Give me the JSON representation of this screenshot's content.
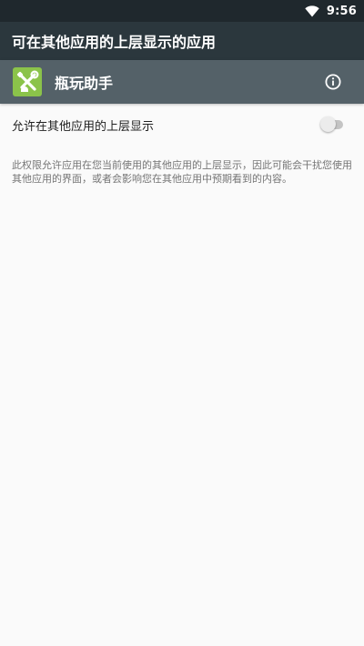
{
  "status_bar": {
    "time": "9:56",
    "icons": [
      "wifi-icon"
    ]
  },
  "app_bar": {
    "title": "可在其他应用的上层显示的应用"
  },
  "app_header": {
    "name": "瓶玩助手",
    "icon": "wrench-icon",
    "action_icon": "info-icon"
  },
  "setting": {
    "label": "允许在其他应用的上层显示",
    "enabled": false
  },
  "description": "此权限允许应用在您当前使用的其他应用的上层显示，因此可能会干扰您使用其他应用的界面，或者会影响您在其他应用中预期看到的内容。",
  "colors": {
    "status_bar": "#1f282d",
    "app_bar": "#2b373d",
    "app_header": "#546168",
    "app_icon_bg": "#8bc34a",
    "background": "#fafafa",
    "toggle_track": "#c4c4c4"
  }
}
